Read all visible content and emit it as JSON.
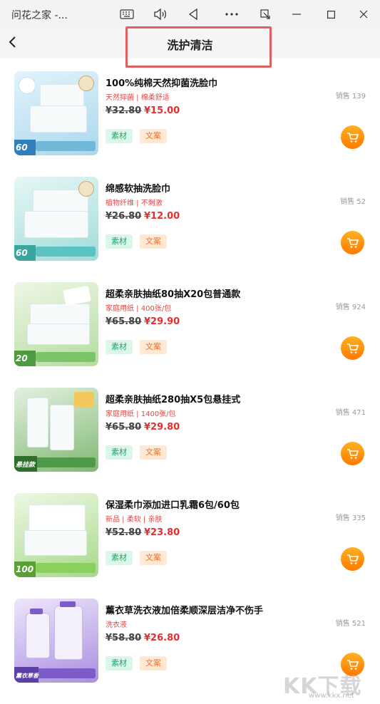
{
  "window": {
    "title": "问花之家 -..."
  },
  "header": {
    "title": "洗护清洁"
  },
  "products": [
    {
      "name": "100%纯棉天然抑菌洗脸巾",
      "subtitle": "天然抑菌 | 棉柔舒适",
      "sales": "销售 139",
      "old_price": "¥32.80",
      "new_price": "¥15.00",
      "chip_material": "素材",
      "chip_copy": "文案",
      "thumb_count": "60",
      "thumb_color": "#6fb8d8"
    },
    {
      "name": "绵感软抽洗脸巾",
      "subtitle": "植物纤维 | 不刺激",
      "sales": "销售 52",
      "old_price": "¥26.80",
      "new_price": "¥12.00",
      "chip_material": "素材",
      "chip_copy": "文案",
      "thumb_count": "60",
      "thumb_color": "#5cc4c0"
    },
    {
      "name": "超柔亲肤抽纸80抽X20包普通款",
      "subtitle": "家庭用纸 | 400张/包",
      "sales": "销售 924",
      "old_price": "¥65.80",
      "new_price": "¥29.90",
      "chip_material": "素材",
      "chip_copy": "文案",
      "thumb_count": "20",
      "thumb_color": "#7bc46a"
    },
    {
      "name": "超柔亲肤抽纸280抽X5包悬挂式",
      "subtitle": "家庭用纸 | 1400张/包",
      "sales": "销售 471",
      "old_price": "¥65.80",
      "new_price": "¥29.80",
      "chip_material": "素材",
      "chip_copy": "文案",
      "thumb_count": "悬挂款",
      "thumb_color": "#4f9a48"
    },
    {
      "name": "保湿柔巾添加进口乳霜6包/60包",
      "subtitle": "新品 | 柔软 | 亲肤",
      "sales": "销售 335",
      "old_price": "¥52.80",
      "new_price": "¥23.80",
      "chip_material": "素材",
      "chip_copy": "文案",
      "thumb_count": "100",
      "thumb_color": "#8bcf5c"
    },
    {
      "name": "薰衣草洗衣液加倍柔顺深层洁净不伤手",
      "subtitle": "洗衣液",
      "sales": "销售 521",
      "old_price": "¥58.80",
      "new_price": "¥26.80",
      "chip_material": "素材",
      "chip_copy": "文案",
      "thumb_count": "薰衣草香",
      "thumb_color": "#8a6fd0"
    }
  ],
  "watermark": {
    "brand": "KK下载",
    "url": "www.kkx.net"
  },
  "colors": {
    "accent": "#ff8a00",
    "price_red": "#e62e2e",
    "highlight": "#e06060"
  }
}
